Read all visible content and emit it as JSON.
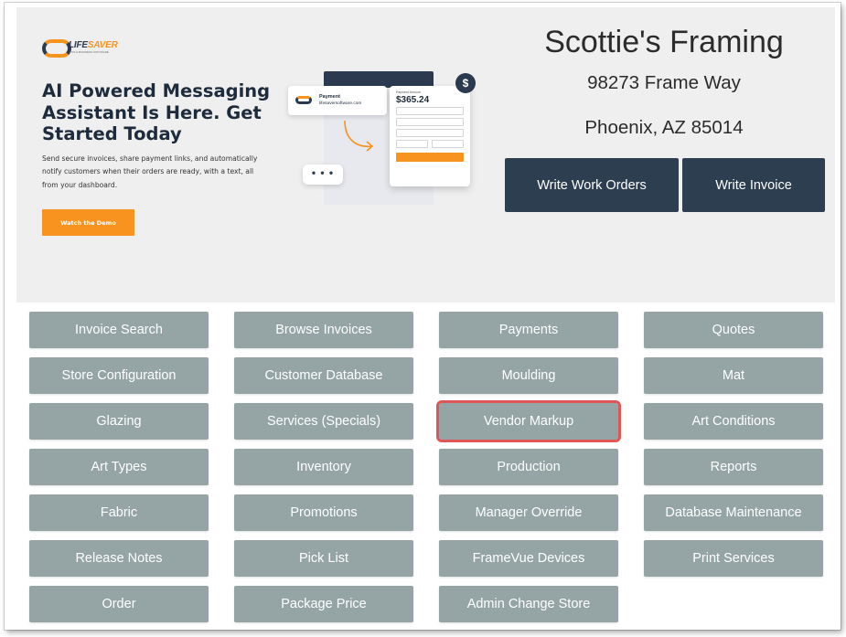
{
  "store": {
    "name": "Scottie's Framing",
    "address_line1": "98273 Frame Way",
    "address_line2": "Phoenix, AZ 85014"
  },
  "actions": {
    "work_orders": "Write Work Orders",
    "invoice": "Write Invoice"
  },
  "banner": {
    "logo_text_a": "LIFE",
    "logo_text_b": "SAVER",
    "logo_sub": "POS & BUSINESS SOFTWARE",
    "headline": "AI Powered Messaging Assistant Is Here. Get Started Today",
    "description": "Send secure invoices, share payment links, and automatically notify customers when their orders are ready, with a text, all from your dashboard.",
    "cta": "Watch the Demo",
    "mock": {
      "payment_title": "Payment",
      "payment_site": "lifesaversoftware.com",
      "amount_label": "Payment Amount",
      "amount": "$365.24",
      "dots": "• • •",
      "dollar": "$"
    }
  },
  "menu_buttons": [
    {
      "label": "Invoice Search",
      "name": "invoice-search-button"
    },
    {
      "label": "Browse Invoices",
      "name": "browse-invoices-button"
    },
    {
      "label": "Payments",
      "name": "payments-button"
    },
    {
      "label": "Quotes",
      "name": "quotes-button"
    },
    {
      "label": "Store Configuration",
      "name": "store-configuration-button"
    },
    {
      "label": "Customer Database",
      "name": "customer-database-button"
    },
    {
      "label": "Moulding",
      "name": "moulding-button"
    },
    {
      "label": "Mat",
      "name": "mat-button"
    },
    {
      "label": "Glazing",
      "name": "glazing-button"
    },
    {
      "label": "Services (Specials)",
      "name": "services-specials-button"
    },
    {
      "label": "Vendor Markup",
      "name": "vendor-markup-button",
      "highlighted": true
    },
    {
      "label": "Art Conditions",
      "name": "art-conditions-button"
    },
    {
      "label": "Art Types",
      "name": "art-types-button"
    },
    {
      "label": "Inventory",
      "name": "inventory-button"
    },
    {
      "label": "Production",
      "name": "production-button"
    },
    {
      "label": "Reports",
      "name": "reports-button"
    },
    {
      "label": "Fabric",
      "name": "fabric-button"
    },
    {
      "label": "Promotions",
      "name": "promotions-button"
    },
    {
      "label": "Manager Override",
      "name": "manager-override-button"
    },
    {
      "label": "Database Maintenance",
      "name": "database-maintenance-button"
    },
    {
      "label": "Release Notes",
      "name": "release-notes-button"
    },
    {
      "label": "Pick List",
      "name": "pick-list-button"
    },
    {
      "label": "FrameVue Devices",
      "name": "framevue-devices-button"
    },
    {
      "label": "Print Services",
      "name": "print-services-button"
    },
    {
      "label": "Order",
      "name": "order-button"
    },
    {
      "label": "Package Price",
      "name": "package-price-button"
    },
    {
      "label": "Admin Change Store",
      "name": "admin-change-store-button"
    }
  ],
  "colors": {
    "menu_button": "#95a5a6",
    "dark_button": "#2d3e50",
    "accent_orange": "#f7931e",
    "highlight_outline": "#e05555",
    "panel_background": "#efefef"
  }
}
